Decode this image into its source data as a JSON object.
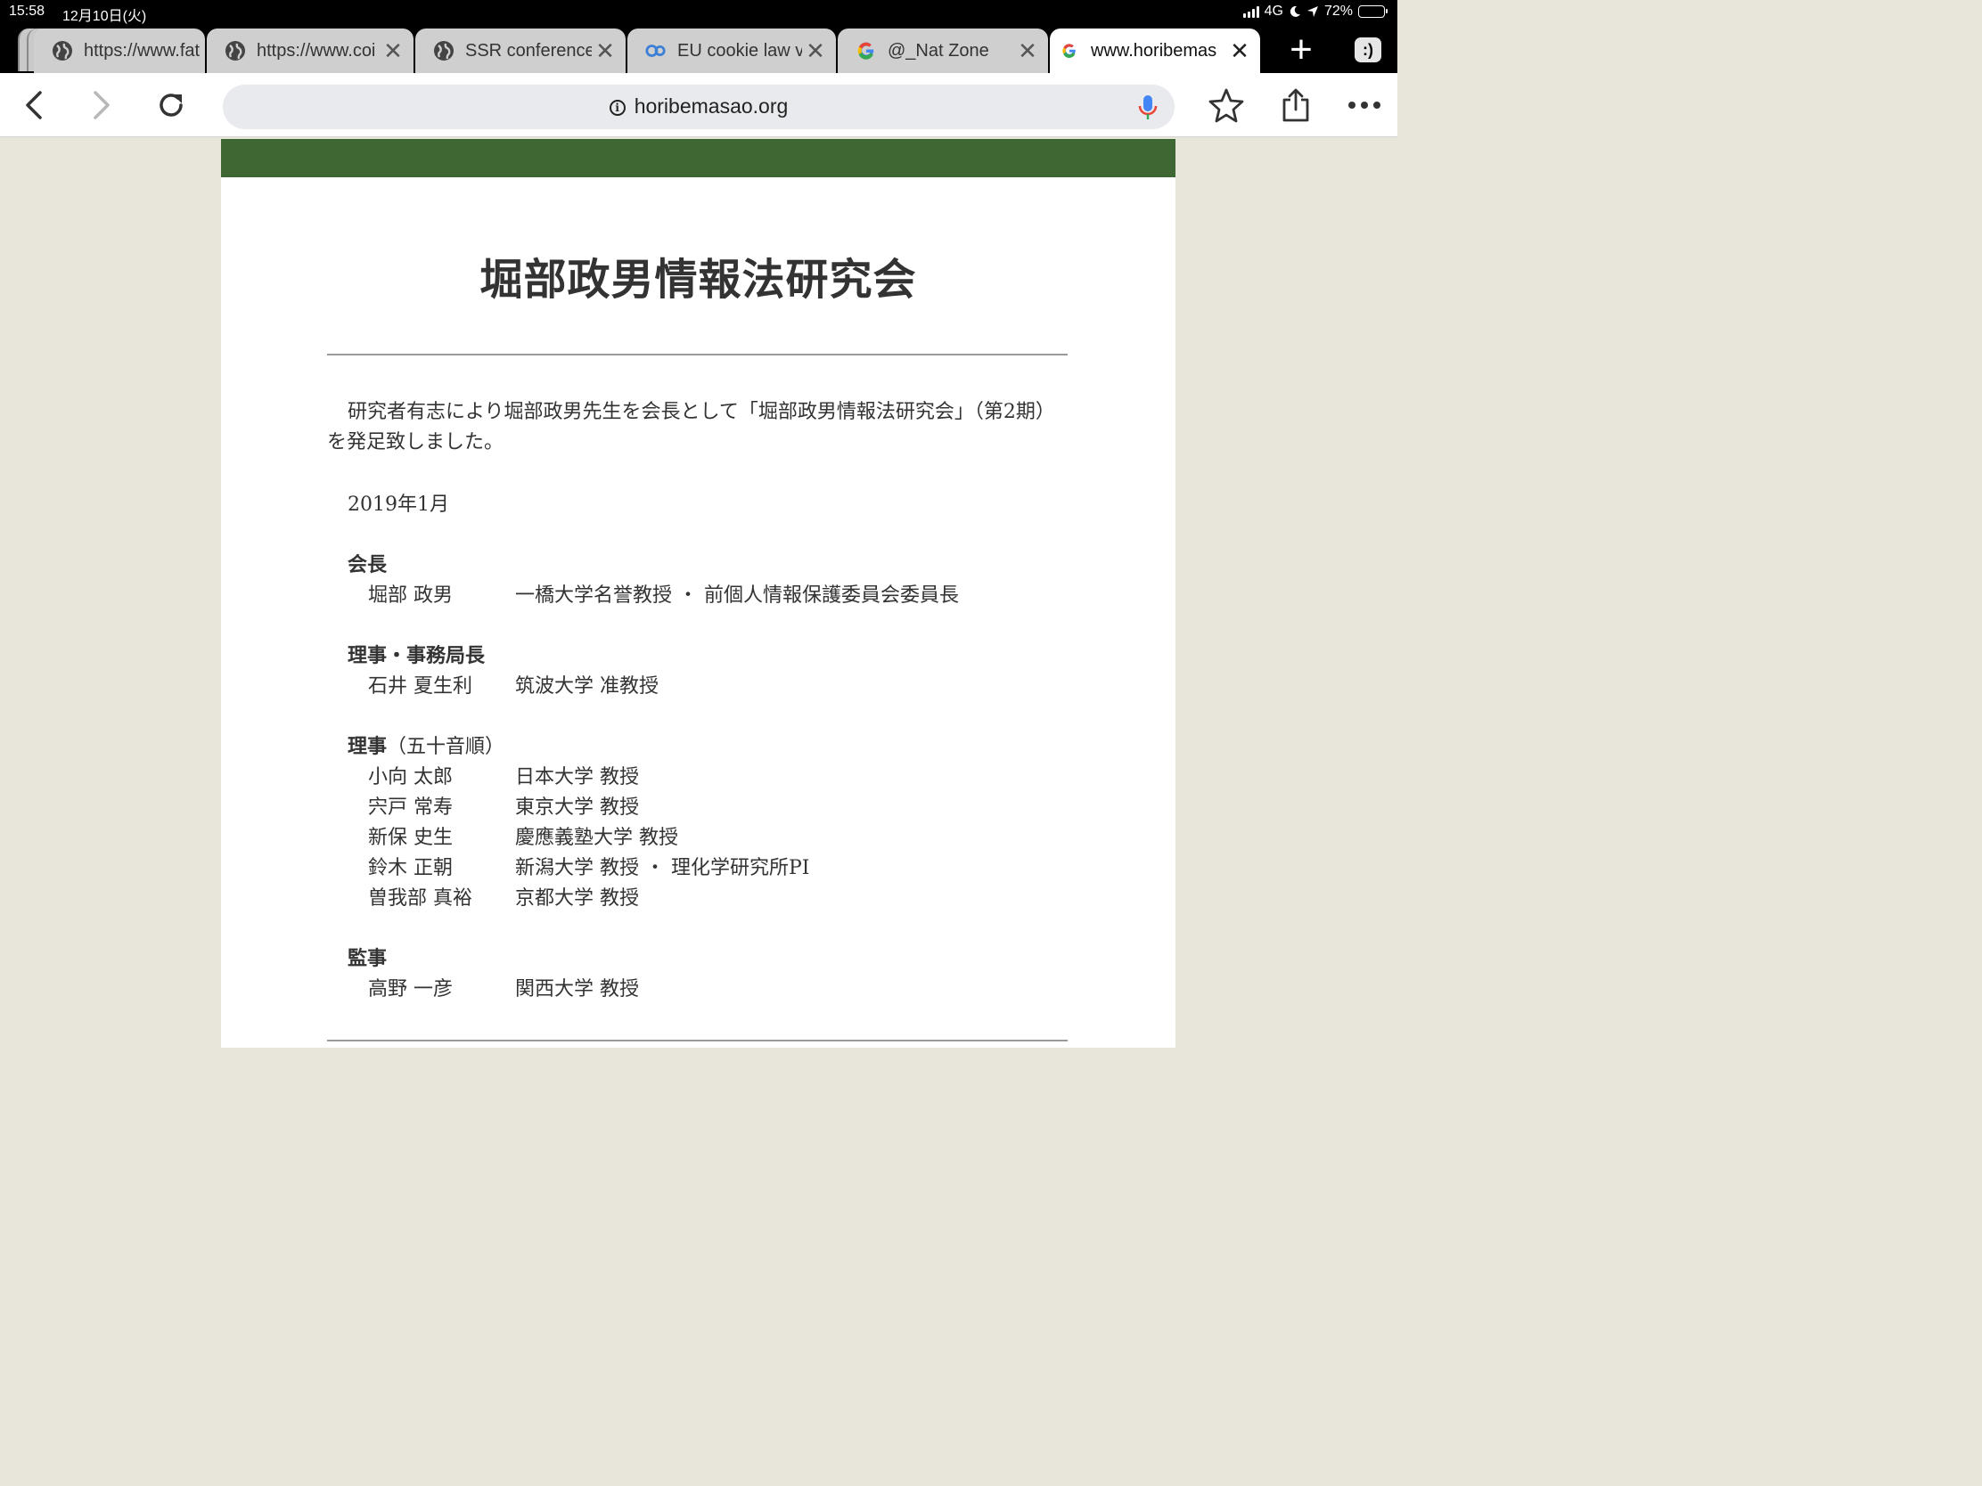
{
  "status_bar": {
    "time": "15:58",
    "date": "12月10日(火)",
    "network": "4G",
    "battery_percent": "72%",
    "battery_level": 0.72,
    "icons": [
      "signal-icon",
      "moon-icon",
      "location-arrow-icon",
      "battery-icon"
    ]
  },
  "tabs": [
    {
      "title": "https://www.fat",
      "icon": "globe-icon",
      "active": false
    },
    {
      "title": "https://www.coi",
      "icon": "globe-icon",
      "active": false
    },
    {
      "title": "SSR conference",
      "icon": "globe-icon",
      "active": false
    },
    {
      "title": "EU cookie law v",
      "icon": "cookie-site-icon",
      "active": false
    },
    {
      "title": "@_Nat Zone",
      "icon": "google-icon",
      "active": false
    },
    {
      "title": "www.horibemas",
      "icon": "google-icon",
      "active": true
    }
  ],
  "tab_strip": {
    "new_tab_icon": "plus-icon",
    "tab_switcher_label": ":)"
  },
  "toolbar": {
    "url": "horibemasao.org",
    "icons": [
      "back-icon",
      "forward-icon",
      "reload-icon",
      "info-icon",
      "mic-icon",
      "star-icon",
      "share-icon",
      "more-icon"
    ]
  },
  "colors": {
    "header_band": "#3f6734",
    "page_background": "#e8e6da"
  },
  "page": {
    "title": "堀部政男情報法研究会",
    "intro": "研究者有志により堀部政男先生を会長として「堀部政男情報法研究会」（第2期）を発足致しました。",
    "date": "2019年1月",
    "sections": [
      {
        "heading": "会長",
        "heading_note": "",
        "members": [
          {
            "name": "堀部 政男",
            "role": "一橋大学名誉教授 ・ 前個人情報保護委員会委員長"
          }
        ]
      },
      {
        "heading": "理事・事務局長",
        "heading_note": "",
        "members": [
          {
            "name": "石井 夏生利",
            "role": "筑波大学 准教授"
          }
        ]
      },
      {
        "heading": "理事",
        "heading_note": "（五十音順）",
        "members": [
          {
            "name": "小向 太郎",
            "role": "日本大学 教授"
          },
          {
            "name": "宍戸 常寿",
            "role": "東京大学 教授"
          },
          {
            "name": "新保 史生",
            "role": "慶應義塾大学 教授"
          },
          {
            "name": "鈴木 正朝",
            "role": "新潟大学 教授 ・ 理化学研究所PI"
          },
          {
            "name": "曽我部 真裕",
            "role": "京都大学 教授"
          }
        ]
      },
      {
        "heading": "監事",
        "heading_note": "",
        "members": [
          {
            "name": "高野 一彦",
            "role": "関西大学 教授"
          }
        ]
      }
    ]
  }
}
